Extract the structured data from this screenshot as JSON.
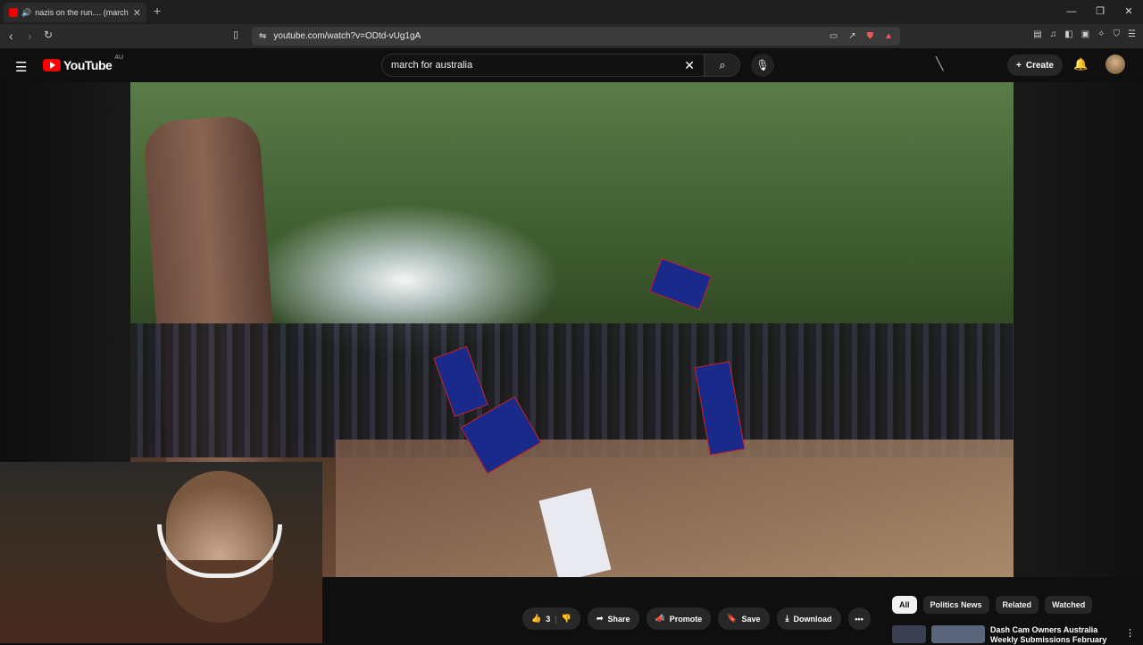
{
  "browser": {
    "tab_title": "nazis on the run.... (march for",
    "new_tab": "+",
    "tab_close": "✕",
    "url": "youtube.com/watch?v=ODtd-vUg1gA",
    "window_controls": [
      "—",
      "❐",
      "✕"
    ]
  },
  "youtube": {
    "logo_text": "YouTube",
    "country_code": "AU",
    "search_value": "march for australia",
    "create_label": "Create"
  },
  "actions": {
    "like_count": "3",
    "share": "Share",
    "promote": "Promote",
    "save": "Save",
    "download": "Download"
  },
  "chips": [
    "All",
    "Politics News",
    "Related",
    "Watched"
  ],
  "recommendation": {
    "title": "Dash Cam Owners Australia Weekly Submissions February"
  },
  "colors": {
    "background": "#0f0f0f",
    "brand_red": "#ff0000",
    "pill": "#272727"
  }
}
